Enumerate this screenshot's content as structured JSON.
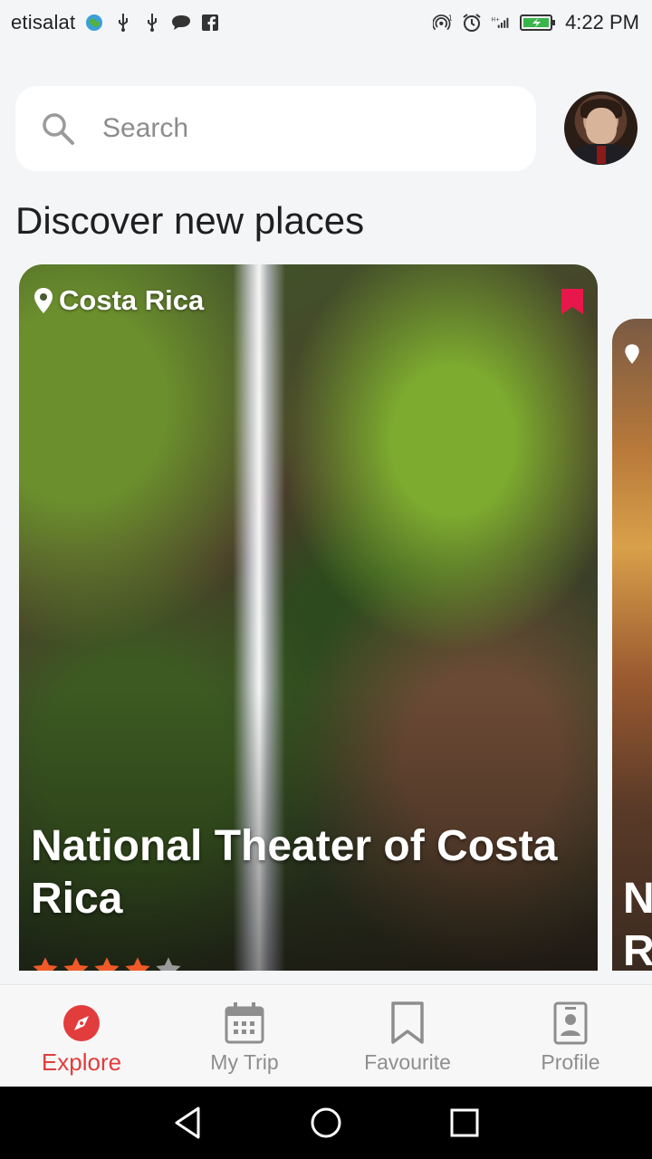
{
  "status_bar": {
    "carrier": "etisalat",
    "time": "4:22 PM"
  },
  "search": {
    "placeholder": "Search"
  },
  "section_title": "Discover new places",
  "cards": [
    {
      "location": "Costa Rica",
      "title": "National Theater of Costa Rica",
      "rating": 4,
      "rating_max": 5
    }
  ],
  "peek_card": {
    "text_partial": "N\nR"
  },
  "bottom_nav": {
    "items": [
      {
        "label": "Explore",
        "icon": "compass-icon",
        "active": true
      },
      {
        "label": "My Trip",
        "icon": "calendar-icon",
        "active": false
      },
      {
        "label": "Favourite",
        "icon": "bookmark-icon",
        "active": false
      },
      {
        "label": "Profile",
        "icon": "profile-badge-icon",
        "active": false
      }
    ]
  },
  "colors": {
    "accent": "#e23d3d",
    "bookmark": "#e8174b",
    "star": "#f05a28",
    "inactive": "#8e8e8e"
  }
}
